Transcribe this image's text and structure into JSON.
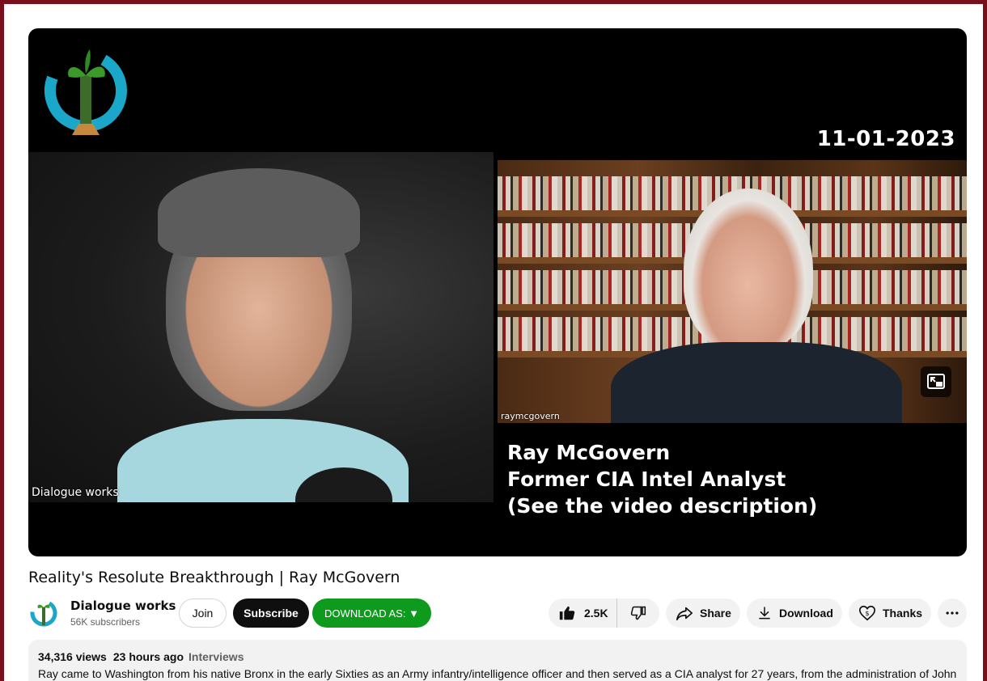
{
  "video": {
    "date_overlay": "11-01-2023",
    "left_participant_label": "Dialogue works",
    "right_participant_label": "raymcgovern",
    "caption_lines": [
      "Ray McGovern",
      "Former CIA Intel Analyst",
      "(See the video description)"
    ],
    "logo_text": "Dialogue works"
  },
  "title": "Reality's Resolute Breakthrough | Ray McGovern",
  "channel": {
    "name": "Dialogue works",
    "subscribers": "56K subscribers",
    "join_label": "Join",
    "subscribe_label": "Subscribe",
    "download_as_label": "DOWNLOAD AS: ▼"
  },
  "actions": {
    "likes": "2.5K",
    "share_label": "Share",
    "download_label": "Download",
    "thanks_label": "Thanks"
  },
  "description": {
    "views": "34,316 views",
    "time": "23 hours ago",
    "tag": "Interviews",
    "text": "Ray came to Washington from his native Bronx in the early Sixties as an Army infantry/intelligence officer and then served as a CIA analyst for 27 years, from the administration of John"
  },
  "colors": {
    "frame": "#7a0f1c",
    "subscribe_bg": "#0f0f0f",
    "download_as_bg": "#0d9a1d",
    "pill_bg": "#f2f2f2"
  }
}
